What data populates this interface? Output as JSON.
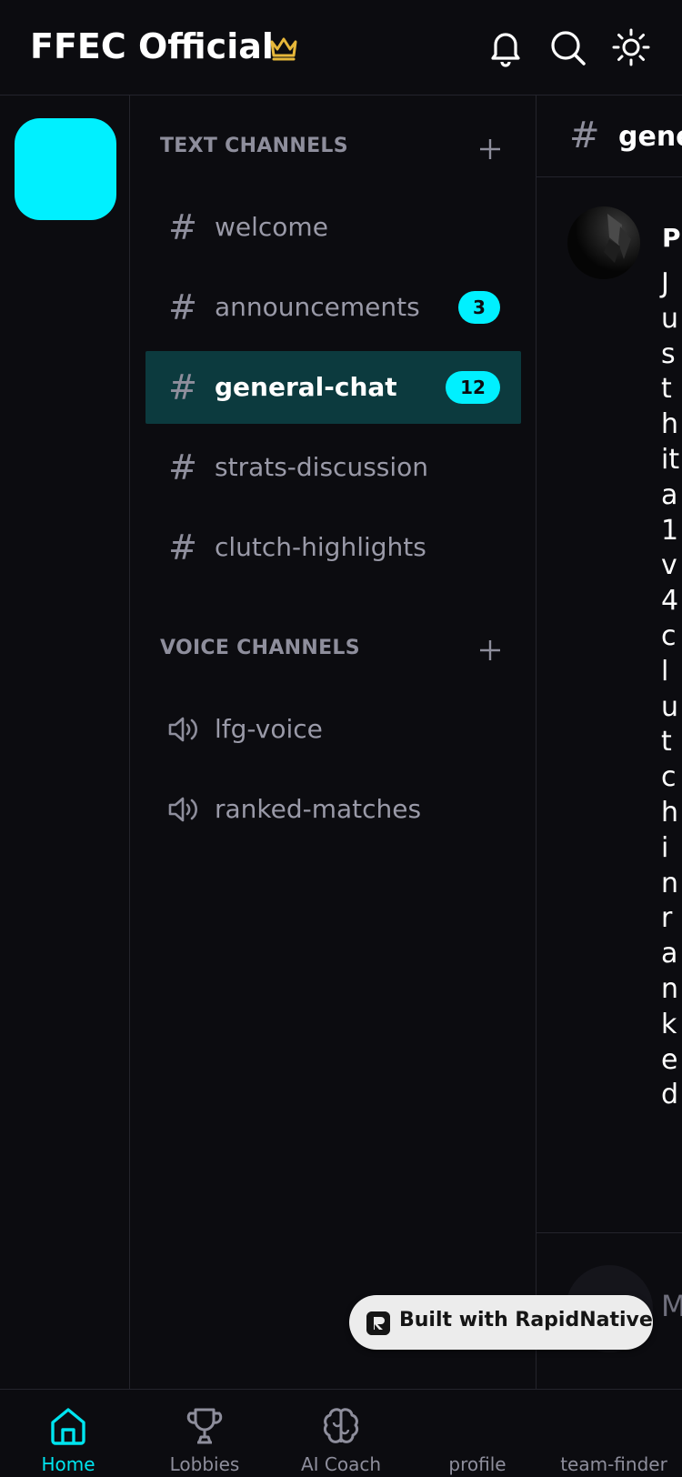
{
  "header": {
    "title": "FFEC Official",
    "icons": [
      "crown-icon",
      "bell-icon",
      "search-icon",
      "sun-icon"
    ]
  },
  "colors": {
    "background": "#0c0c10",
    "accent": "#00f0ff",
    "active_channel_bg": "#0c3a3e",
    "crown": "#e6b73a",
    "muted_text": "#8e8e9c"
  },
  "server": {
    "icon_color": "#00f0ff"
  },
  "sections": {
    "text_title": "TEXT CHANNELS",
    "voice_title": "VOICE CHANNELS"
  },
  "text_channels": [
    {
      "name": "welcome",
      "badge": ""
    },
    {
      "name": "announcements",
      "badge": "3"
    },
    {
      "name": "general-chat",
      "badge": "12",
      "active": true
    },
    {
      "name": "strats-discussion",
      "badge": ""
    },
    {
      "name": "clutch-highlights",
      "badge": ""
    }
  ],
  "voice_channels": [
    {
      "name": "lfg-voice"
    },
    {
      "name": "ranked-matches"
    }
  ],
  "chat": {
    "channel_title": "general-chat",
    "author": "Pr",
    "message": "Just hit a 1v4 clutch in ranked!",
    "composer_placeholder": "M"
  },
  "badge": {
    "text": "Built with RapidNative"
  },
  "tabs": [
    {
      "label": "Home",
      "icon": "home-icon",
      "active": true
    },
    {
      "label": "Lobbies",
      "icon": "trophy-icon"
    },
    {
      "label": "AI Coach",
      "icon": "brain-icon"
    },
    {
      "label": "profile",
      "icon": ""
    },
    {
      "label": "team-finder",
      "icon": ""
    }
  ]
}
